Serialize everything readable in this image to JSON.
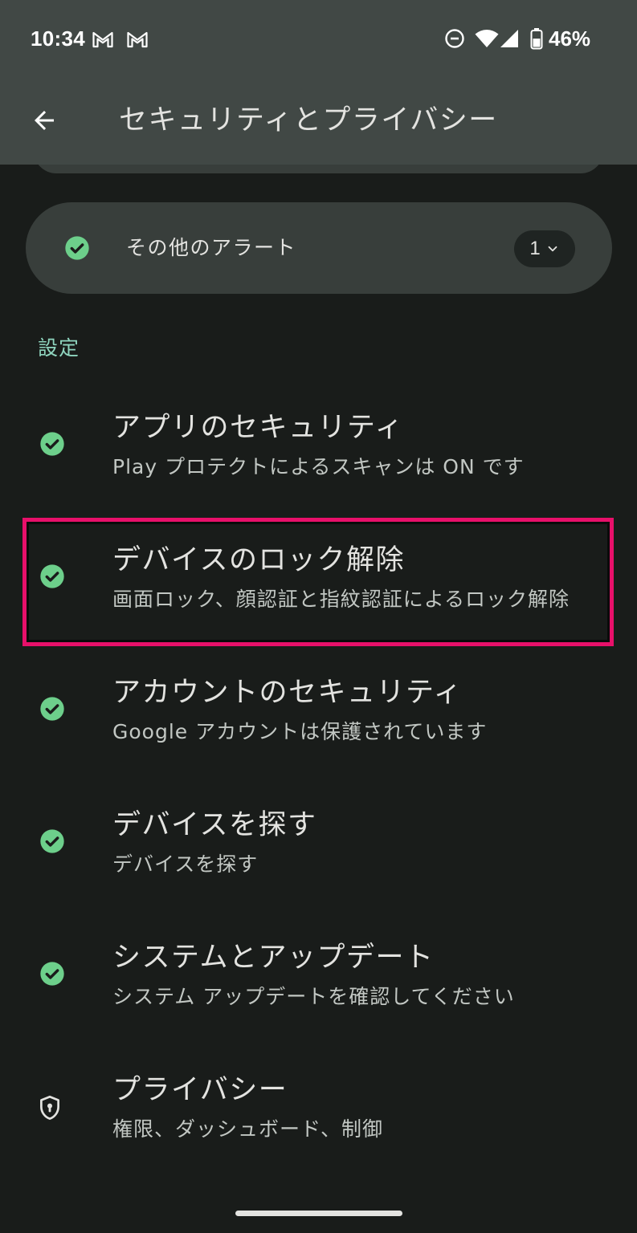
{
  "status_bar": {
    "time": "10:34",
    "notification_icons": [
      "gmail-icon",
      "gmail-icon"
    ],
    "system_icons": [
      "do-not-disturb-icon",
      "wifi-icon",
      "cell-signal-icon",
      "battery-icon"
    ],
    "battery_percent": "46%",
    "battery_level": 0.46
  },
  "app_bar": {
    "back_icon": "back-arrow-icon",
    "title": "セキュリティとプライバシー"
  },
  "alert_card": {
    "icon": "check-circle-icon",
    "label": "その他のアラート",
    "count": "1",
    "expand_icon": "chevron-down-icon"
  },
  "settings_section": {
    "header": "設定",
    "items": [
      {
        "icon": "check-circle-icon",
        "title": "アプリのセキュリティ",
        "subtitle": "Play プロテクトによるスキャンは ON です"
      },
      {
        "icon": "check-circle-icon",
        "title": "デバイスのロック解除",
        "subtitle": "画面ロック、顔認証と指紋認証によるロック解除"
      },
      {
        "icon": "check-circle-icon",
        "title": "アカウントのセキュリティ",
        "subtitle": "Google アカウントは保護されています"
      },
      {
        "icon": "check-circle-icon",
        "title": "デバイスを探す",
        "subtitle": "デバイスを探す"
      },
      {
        "icon": "check-circle-icon",
        "title": "システムとアップデート",
        "subtitle": "システム アップデートを確認してください"
      },
      {
        "icon": "shield-icon",
        "title": "プライバシー",
        "subtitle": "権限、ダッシュボード、制御"
      }
    ]
  },
  "colors": {
    "background": "#191c1a",
    "top_bar": "#414845",
    "card": "#383e3b",
    "pill": "#1f2422",
    "accent": "#8fd5bf",
    "check_green": "#6dcf8b",
    "text_primary": "#e3e3e0",
    "text_secondary": "#c2c7c3",
    "highlight": "#e8106a",
    "nav_handle": "#e3e3e0"
  }
}
